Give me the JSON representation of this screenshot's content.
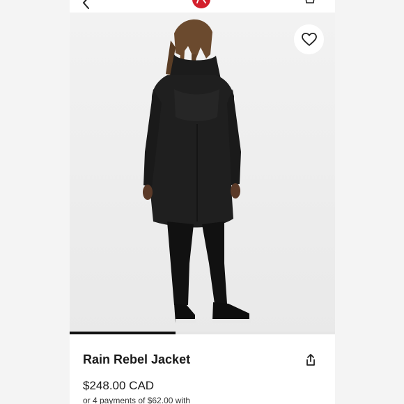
{
  "product": {
    "title": "Rain Rebel Jacket",
    "price": "$248.00 CAD",
    "installments_text": "or 4 payments of $62.00 with"
  },
  "gallery": {
    "progress": 0.4
  },
  "colors": {
    "brand_red": "#d31f2c",
    "text": "#1a1a1a",
    "photo_bg": "#eeeeee"
  },
  "icons": {
    "back": "chevron-left-icon",
    "logo": "lululemon-logo",
    "bag": "shopping-bag-icon",
    "favorite": "heart-icon",
    "share": "share-icon"
  }
}
